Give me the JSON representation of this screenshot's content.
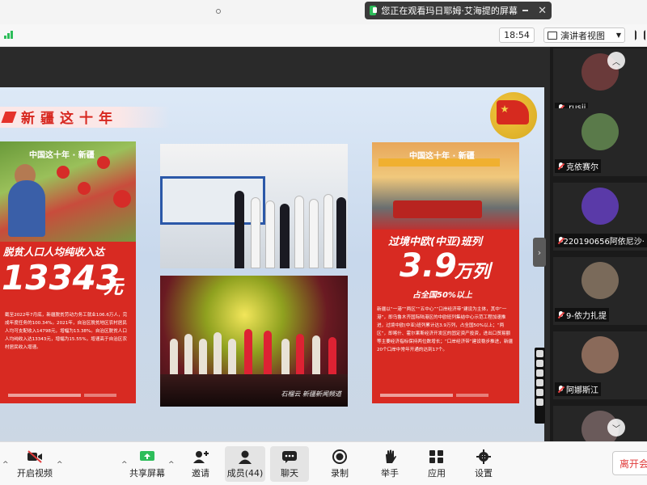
{
  "share_banner": {
    "text": "您正在观看玛日耶姆·艾海提的屏幕"
  },
  "meeting": {
    "timer": "18:54",
    "view_label": "演讲者视图"
  },
  "slide": {
    "title": "新疆这十年",
    "left_card": {
      "tag": "中国这十年 · 新疆",
      "headline": "脱贫人口人均纯收入达",
      "big_number": "13343",
      "unit": "元",
      "body": "截至2022年7月底，新疆脱贫劳动力务工就业106.6万人，完成年度任务的100.34%。2021年，自治区脱贫地区农村居民人均可支配收入14798元，增幅为13.38%。自治区脱贫人口人均纯收入达13343元，增幅为15.55%，增速高于自治区农村居民收入增速。"
    },
    "right_card": {
      "tag": "中国这十年 · 新疆",
      "headline": "过境中欧(中亚)班列",
      "big_number": "3.9",
      "unit": "万列",
      "subhead": "占全国50%以上",
      "body": "新疆以“一港”“两区”“五中心”“口岸经济带”建设为主体，其中“一港”，即乌鲁木齐国际陆港区的中欧班列集结中心示范工程加速推进，过境中欧(中亚)班列累计达3.9万列，占全国50%以上；“两区”，即喀什、霍尔果斯经济开发区的固定资产投资，进出口贸易额等主要经济指标保持两位数增长；“口岸经济带”建设稳步推进，新疆20个口岸中常年开通的达到17个。"
    },
    "stage_caption": "石榴云 新疆新闻频道"
  },
  "participants": [
    {
      "name": ".rusii",
      "color": "#6a3a3a"
    },
    {
      "name": "克依赛尔",
      "color": "#5a7a4a"
    },
    {
      "name": "220190656阿依尼沙·",
      "color": "#5a3aa8"
    },
    {
      "name": "9-依力扎提",
      "color": "#7a6a5a"
    },
    {
      "name": "阿娜斯江",
      "color": "#8a6a5a"
    },
    {
      "name": "",
      "color": "#6a5a5a"
    }
  ],
  "toolbar": {
    "video": "开启视频",
    "share": "共享屏幕",
    "invite": "邀请",
    "members": "成员(44)",
    "chat": "聊天",
    "record": "录制",
    "raise_hand": "举手",
    "apps": "应用",
    "settings": "设置",
    "leave": "离开会"
  },
  "colors": {
    "accent": "#d82a22",
    "share_green": "#2dbd5a",
    "leave_red": "#e03a3a"
  }
}
